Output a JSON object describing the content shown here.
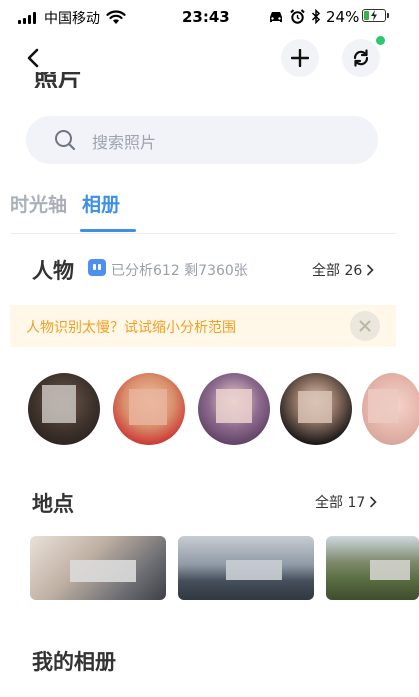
{
  "status_bar": {
    "carrier": "中国移动",
    "time": "23:43",
    "battery_percent": "24%",
    "battery_level": 0.24,
    "accent_green": "#3ab14a"
  },
  "nav": {
    "back_icon": "chevron-left-icon",
    "add_icon": "plus-icon",
    "sync_icon": "sync-icon",
    "partial_title": "照片",
    "notification_dot_color": "#2dc86c"
  },
  "search": {
    "placeholder": "搜索照片"
  },
  "tabs": [
    {
      "label": "时光轴",
      "active": false
    },
    {
      "label": "相册",
      "active": true
    }
  ],
  "accent_blue": "#3d8fe8",
  "people": {
    "title": "人物",
    "analysis": "已分析612 剩7360张",
    "all_label": "全部 26"
  },
  "banner": {
    "text": "人物识别太慢？试试缩小分析范围",
    "color": "#f0a020"
  },
  "places": {
    "title": "地点",
    "all_label": "全部 17"
  },
  "my_albums": {
    "title": "我的相册"
  }
}
